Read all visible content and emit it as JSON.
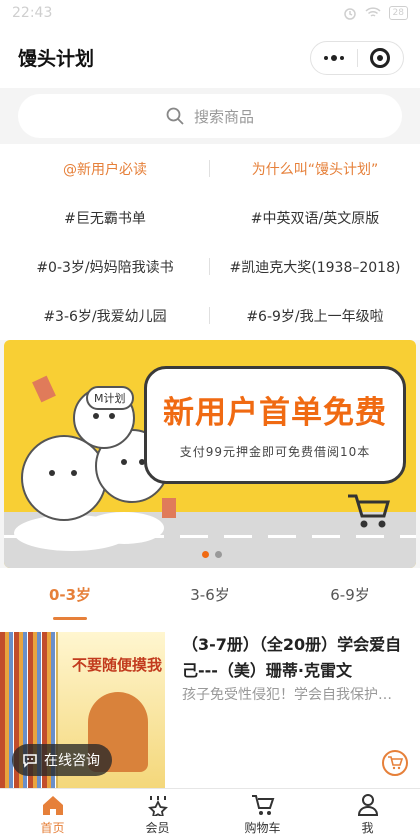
{
  "status_bar": {
    "time": "22:43",
    "battery": "28"
  },
  "nav": {
    "title": "馒头计划"
  },
  "search": {
    "placeholder": "搜索商品"
  },
  "quick_links": [
    {
      "left": "@新用户必读",
      "right": "为什么叫“馒头计划”"
    },
    {
      "left": "#巨无霸书单",
      "right": "#中英双语/英文原版"
    },
    {
      "left": "#0-3岁/妈妈陪我读书",
      "right": "#凯迪克大奖(1938–2018)"
    },
    {
      "left": "#3-6岁/我爱幼儿园",
      "right": "#6-9岁/我上一年级啦"
    }
  ],
  "banner": {
    "headline": "新用户首单免费",
    "subline": "支付99元押金即可免费借阅10本",
    "badge": "M计划",
    "slide_count": 2,
    "active_slide": 1
  },
  "age_tabs": [
    "0-3岁",
    "3-6岁",
    "6-9岁"
  ],
  "active_tab": "0-3岁",
  "product": {
    "title": "（3-7册）（全20册）学会爱自己---（美）珊蒂·克雷文",
    "subtitle": "孩子免受性侵犯！学会自我保护、自...",
    "cover_title": "不要随便摸我"
  },
  "consult_label": "在线咨询",
  "tabbar": [
    {
      "label": "首页",
      "icon": "home-icon",
      "active": true
    },
    {
      "label": "会员",
      "icon": "crown-icon",
      "active": false
    },
    {
      "label": "购物车",
      "icon": "cart-icon",
      "active": false
    },
    {
      "label": "我",
      "icon": "user-icon",
      "active": false
    }
  ],
  "colors": {
    "accent": "#e6803a",
    "banner_bg": "#f8cf34",
    "headline": "#f06a12"
  }
}
